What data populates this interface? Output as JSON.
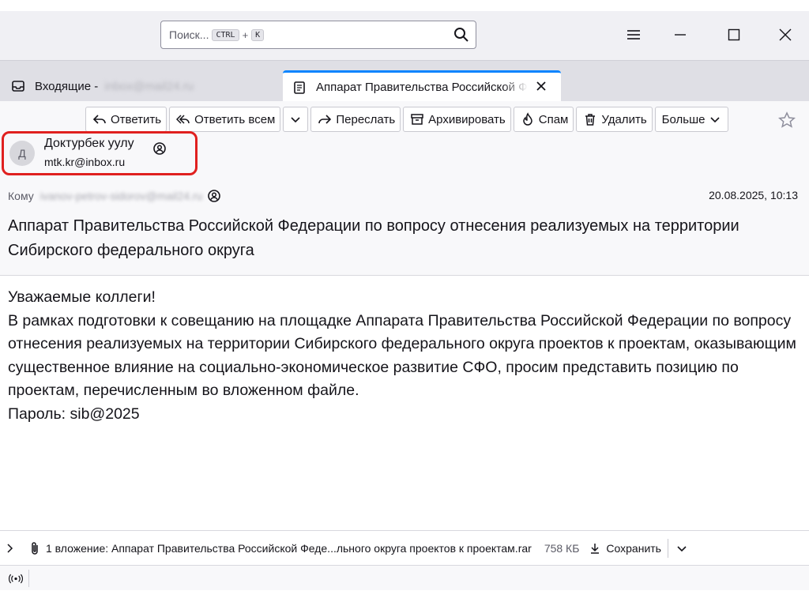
{
  "search": {
    "placeholder": "Поиск...",
    "kbd1": "CTRL",
    "plus": "+",
    "kbd2": "K"
  },
  "tabs": [
    {
      "label": "Входящие -",
      "account": "inbox@mail24.ru",
      "icon": "inbox-icon"
    },
    {
      "label": "Аппарат Правительства Российской Федерации",
      "icon": "message-icon"
    }
  ],
  "toolbar": {
    "reply": "Ответить",
    "reply_all": "Ответить всем",
    "forward": "Переслать",
    "archive": "Архивировать",
    "spam": "Спам",
    "delete": "Удалить",
    "more": "Больше"
  },
  "sender": {
    "avatar_letter": "Д",
    "name": "Доктурбек уулу",
    "email": "mtk.kr@inbox.ru"
  },
  "to": {
    "label": "Кому",
    "value": "ivanov-petrov-sidorov@mail24.ru"
  },
  "date": "20.08.2025, 10:13",
  "subject": "Аппарат Правительства Российской Федерации по вопросу отнесения реализуемых на территории Сибирского федерального округа",
  "body": {
    "greeting": "Уважаемые коллеги!",
    "paragraph": "В рамках подготовки к совещанию на площадке Аппарата Правительства Российской Федерации по вопросу отнесения реализуемых на территории Сибирского федерального округа проектов к проектам, оказывающим существенное влияние на социально-экономическое развитие СФО, просим представить позицию по проектам, перечисленным во вложенном файле.",
    "password": "Пароль: sib@2025"
  },
  "attachment": {
    "text": "1 вложение: Аппарат Правительства Российской Феде...льного округа проектов к проектам.rar",
    "size": "758 КБ",
    "save": "Сохранить"
  },
  "colors": {
    "highlight": "#e0201f",
    "tab_accent": "#0a84ff"
  }
}
